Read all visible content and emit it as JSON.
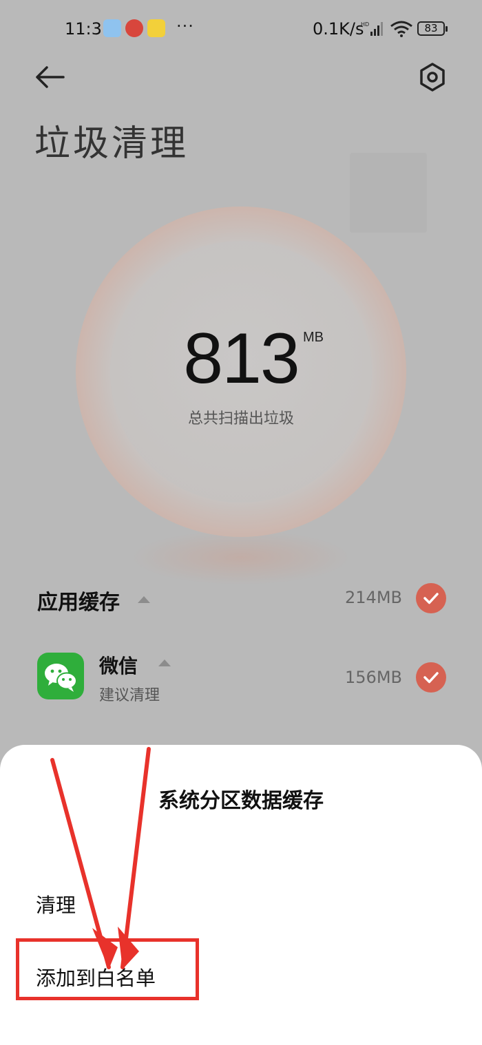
{
  "status_bar": {
    "time": "11:31",
    "more": "···",
    "network_speed": "0.1K/s",
    "battery": "83",
    "notification_icons": [
      "tv-app-icon",
      "mushroom-app-icon",
      "music-app-icon"
    ]
  },
  "header": {
    "back_icon": "arrow-left-icon",
    "settings_icon": "hexagon-gear-icon",
    "title": "垃圾清理"
  },
  "scan": {
    "value": "813",
    "unit": "MB",
    "caption": "总共扫描出垃圾"
  },
  "section": {
    "title": "应用缓存",
    "size": "214MB",
    "checked": true
  },
  "app_item": {
    "icon": "wechat-icon",
    "name": "微信",
    "subtitle": "建议清理",
    "size": "156MB",
    "checked": true
  },
  "sheet": {
    "title": "系统分区数据缓存",
    "items": [
      {
        "label": "清理"
      },
      {
        "label": "添加到白名单"
      }
    ]
  },
  "colors": {
    "overlay_gray": "#b9b9b9",
    "check_red": "#d66252",
    "annotation_red": "#e8322b",
    "wechat_green": "#2fae3b"
  }
}
